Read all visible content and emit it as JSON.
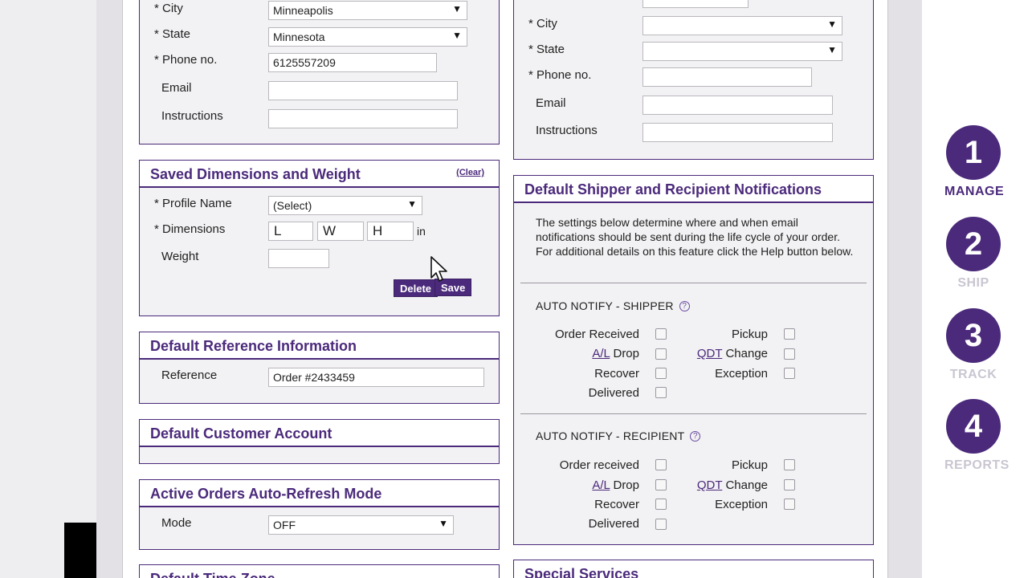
{
  "left_panel": {
    "fields": {
      "city_label": "* City",
      "city_value": "Minneapolis",
      "state_label": "* State",
      "state_value": "Minnesota",
      "phone_label": "* Phone no.",
      "phone_value": "6125557209",
      "email_label": "Email",
      "email_value": "",
      "instructions_label": "Instructions",
      "instructions_value": ""
    }
  },
  "right_panel": {
    "fields": {
      "city_label": "* City",
      "state_label": "* State",
      "phone_label": "* Phone no.",
      "email_label": "Email",
      "instructions_label": "Instructions"
    }
  },
  "saved_dimensions": {
    "title": "Saved Dimensions and Weight",
    "clear_link": "(Clear)",
    "profile_label": "* Profile Name",
    "profile_value": "(Select)",
    "dimensions_label": "* Dimensions",
    "length_value": "L",
    "width_value": "W",
    "height_value": "H",
    "unit": "in",
    "weight_label": "Weight",
    "weight_value": "",
    "delete_button": "Delete",
    "save_button": "Save"
  },
  "reference": {
    "title": "Default Reference Information",
    "label": "Reference",
    "value": "Order #2433459"
  },
  "customer_account": {
    "title": "Default Customer Account"
  },
  "auto_refresh": {
    "title": "Active Orders Auto-Refresh Mode",
    "mode_label": "Mode",
    "mode_value": "OFF"
  },
  "time_zone": {
    "title": "Default Time Zone"
  },
  "notifications": {
    "title": "Default Shipper and Recipient Notifications",
    "description": "The settings below determine where and when email notifications should be sent during the life cycle of your order. For additional details on this feature click the Help button below.",
    "shipper": {
      "title": "AUTO NOTIFY - SHIPPER",
      "order_received": "Order Received",
      "al_link": "A/L",
      "drop": "Drop",
      "recover": "Recover",
      "delivered": "Delivered",
      "pickup": "Pickup",
      "qdt_link": "QDT",
      "change": "Change",
      "exception": "Exception"
    },
    "recipient": {
      "title": "AUTO NOTIFY - RECIPIENT",
      "order_received": "Order received",
      "al_link": "A/L",
      "drop": "Drop",
      "recover": "Recover",
      "delivered": "Delivered",
      "pickup": "Pickup",
      "qdt_link": "QDT",
      "change": "Change",
      "exception": "Exception"
    }
  },
  "special_services": {
    "title": "Special Services"
  },
  "help_glyph": "?",
  "arrow_glyph": "▼",
  "steps": [
    {
      "number": "1",
      "label": "MANAGE",
      "state": "active"
    },
    {
      "number": "2",
      "label": "SHIP",
      "state": "inactive"
    },
    {
      "number": "3",
      "label": "TRACK",
      "state": "inactive"
    },
    {
      "number": "4",
      "label": "REPORTS",
      "state": "inactive"
    }
  ],
  "colors": {
    "brand_purple": "#4b2a7b",
    "inactive_step_label": "#c9c6d1"
  }
}
